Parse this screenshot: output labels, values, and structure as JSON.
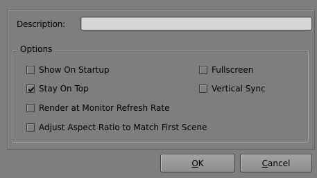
{
  "description": {
    "label": "Description:",
    "value": "",
    "placeholder": ""
  },
  "options": {
    "title": "Options",
    "checkboxes": [
      {
        "label": "Show On Startup",
        "checked": false
      },
      {
        "label": "Fullscreen",
        "checked": false
      },
      {
        "label": "Stay On Top",
        "checked": true
      },
      {
        "label": "Vertical Sync",
        "checked": false
      },
      {
        "label": "Render at Monitor Refresh Rate",
        "checked": false
      },
      {
        "label": "Adjust Aspect Ratio to Match First Scene",
        "checked": false
      }
    ]
  },
  "buttons": {
    "ok": {
      "mnemonic": "O",
      "rest": "K"
    },
    "cancel": {
      "mnemonic": "C",
      "rest": "ancel"
    }
  },
  "colors": {
    "background": "#7e7e7e",
    "input_fill": "#d6d6d6"
  }
}
